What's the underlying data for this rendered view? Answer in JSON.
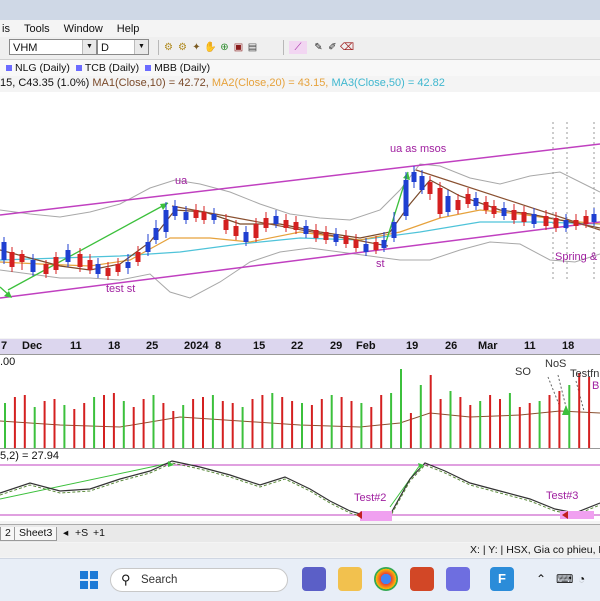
{
  "menu": [
    "is",
    "Tools",
    "Window",
    "Help"
  ],
  "toolbar": {
    "symbol": "VHM",
    "period": "D"
  },
  "symbol_tabs": [
    "NLG (Daily)",
    "TCB (Daily)",
    "MBB (Daily)"
  ],
  "legend": {
    "price": "15, C43.35 (1.0%)",
    "ma1": "MA1(Close,10) = 42.72,",
    "ma2": "MA2(Close,20) = 43.15,",
    "ma3": "MA3(Close,50) = 42.82",
    "ma1_color": "#7a4a2a",
    "ma2_color": "#e6a23c",
    "ma3_color": "#4fc3d9"
  },
  "annotations": {
    "ua_left": "ua",
    "ua_right": "ua as msos",
    "test_st": "test st",
    "st": "st",
    "spring": "Spring &",
    "so": "SO",
    "nos": "NoS",
    "testfn": "Testfn",
    "b": "B",
    "test2": "Test#2",
    "test3": "Test#3"
  },
  "date_axis": [
    "7",
    "Dec",
    "11",
    "18",
    "25",
    "2024",
    "8",
    "15",
    "22",
    "29",
    "Feb",
    "19",
    "26",
    "Mar",
    "11",
    "18"
  ],
  "volume_label": ".00",
  "oscillator_label": "5,2) = 27.94",
  "sheets": [
    "2",
    "Sheet3"
  ],
  "sheet_nav": [
    "◂",
    "+S",
    "+1"
  ],
  "status_text": "X: | Y: | HSX, Gia co phieu, Nonc",
  "taskbar": {
    "search_placeholder": "Search"
  },
  "colors": {
    "up_candle": "#1f3fd1",
    "down_candle": "#d42020",
    "channel": "#c040c0",
    "arrow": "#3cc03c",
    "spring_box": "#f0a0f0"
  }
}
